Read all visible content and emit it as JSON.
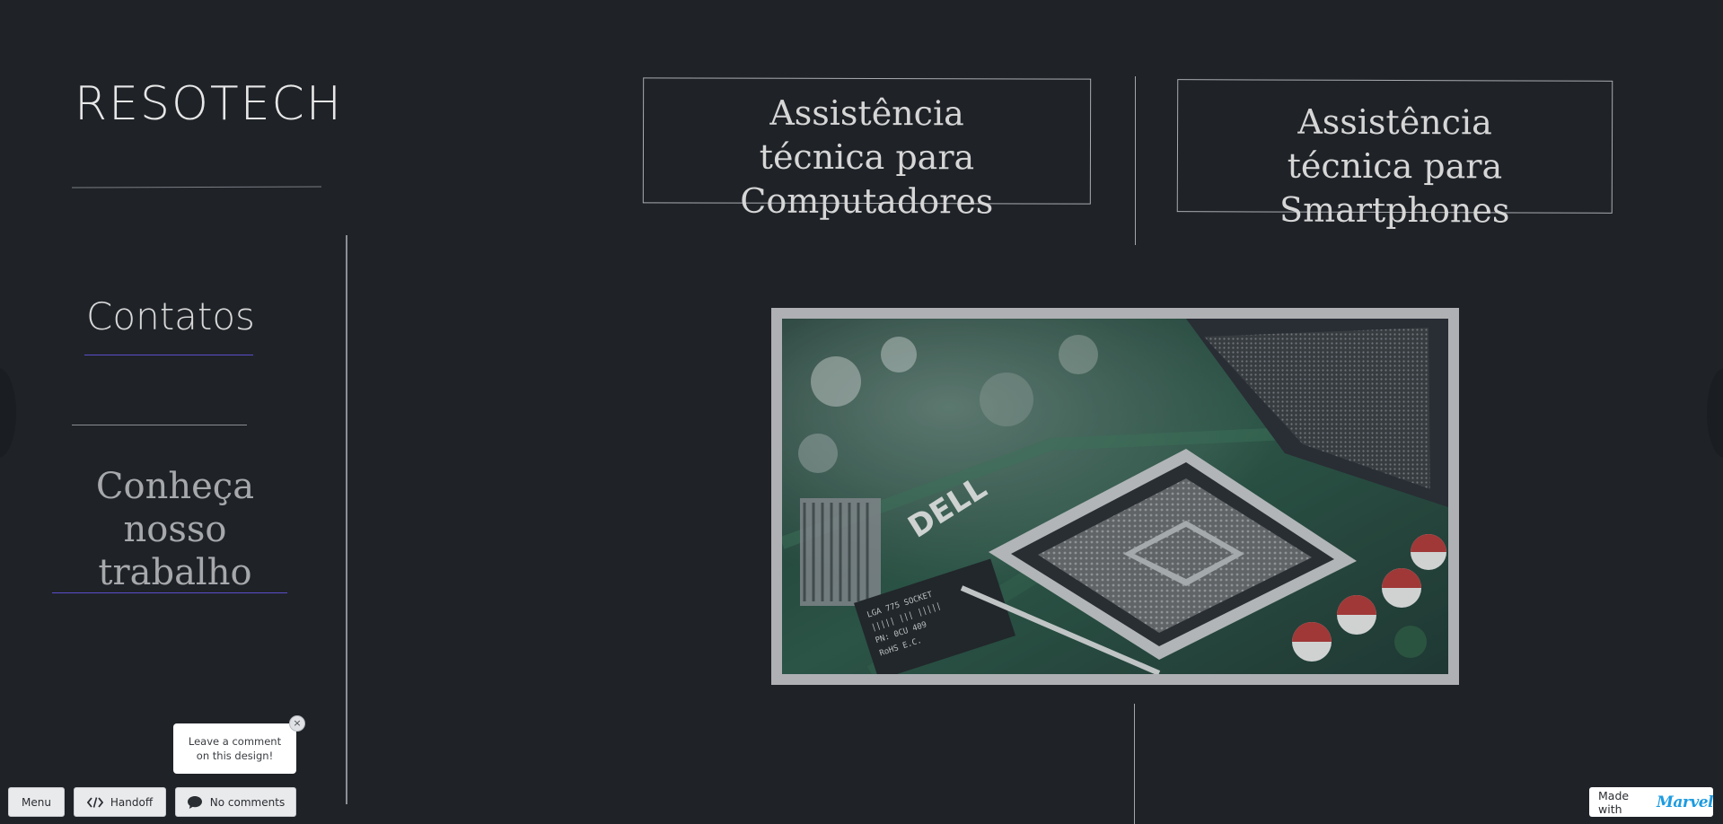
{
  "brand": {
    "title": "RESOTECH"
  },
  "sidebar": {
    "contatos_label": "Contatos",
    "conheca_line1": "Conheça",
    "conheca_line2": "nosso trabalho"
  },
  "services": {
    "computers": {
      "line1": "Assistência",
      "line2": "técnica para Computadores"
    },
    "smartphones": {
      "line1": "Assistência",
      "line2": "técnica para Smartphones"
    }
  },
  "image": {
    "icon": "motherboard-cpu-socket-photo"
  },
  "toolbar": {
    "menu_label": "Menu",
    "handoff_label": "Handoff",
    "comments_label": "No comments",
    "tooltip_text": "Leave a comment on this design!",
    "tooltip_close": "×",
    "made_with_label": "Made with",
    "marvel_logo": "Marvel"
  },
  "colors": {
    "background": "#1f2328",
    "accent_underline": "#5a4cc9",
    "marvel_blue": "#1d9be0"
  }
}
